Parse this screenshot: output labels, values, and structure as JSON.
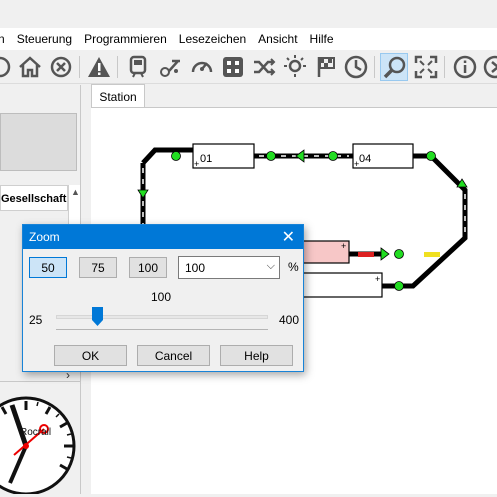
{
  "menu": {
    "items": [
      "n",
      "Steuerung",
      "Programmieren",
      "Lesezeichen",
      "Ansicht",
      "Hilfe"
    ]
  },
  "toolbar": {
    "icons": [
      "power-icon",
      "home-icon",
      "stop-icon",
      "warning-icon",
      "train-icon",
      "locomotive-icon",
      "speedometer-icon",
      "grid-icon",
      "shuffle-icon",
      "light-icon",
      "flag-icon",
      "clock-icon",
      "zoom-icon",
      "fullscreen-icon",
      "info-icon",
      "next-icon"
    ]
  },
  "left_panel": {
    "header_text": "Gesellschaft",
    "scroll_arrow": "▲",
    "chevron": "›",
    "clock_brand": "Rocrail"
  },
  "station": {
    "tab_label": "Station",
    "blocks": [
      {
        "label": "01"
      },
      {
        "label": "04"
      }
    ]
  },
  "zoom_dialog": {
    "title": "Zoom",
    "close_glyph": "✕",
    "preset_50": "50",
    "preset_75": "75",
    "preset_100": "100",
    "select_value": "100",
    "select_arrow": "⌵",
    "unit": "%",
    "current_value": "100",
    "slider_min": "25",
    "slider_max": "400",
    "ok_label": "OK",
    "cancel_label": "Cancel",
    "help_label": "Help"
  },
  "colors": {
    "title_bar": "#0078d7",
    "track": "#000000",
    "signal_green": "#22dd22",
    "signal_red": "#dd2222",
    "occupied_block": "#f7c7c7"
  }
}
